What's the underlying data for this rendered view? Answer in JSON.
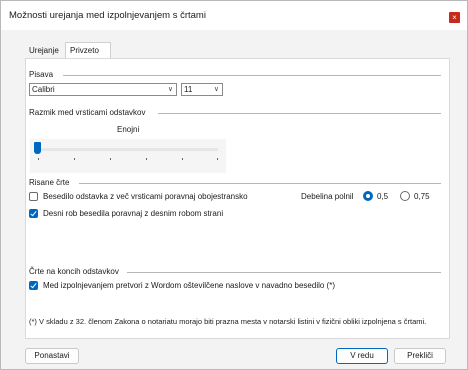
{
  "window": {
    "title": "Možnosti urejanja med izpolnjevanjem s črtami",
    "close_glyph": "×"
  },
  "tabs": [
    {
      "label": "Urejanje",
      "active": false
    },
    {
      "label": "Privzeto",
      "active": true
    }
  ],
  "font_group": {
    "label": "Pisava",
    "font_value": "Calibri",
    "size_value": "11",
    "dropdown_icon": "chevron-down-icon"
  },
  "spacing_group": {
    "label": "Razmik med vrsticami odstavkov",
    "slider_value_label": "Enojni",
    "slider_position": 0
  },
  "lines_group": {
    "label": "Risane črte",
    "justify_checkbox": {
      "label": "Besedilo odstavka z več vrsticami poravnaj obojestransko",
      "checked": false
    },
    "right_edge_checkbox": {
      "label": "Desni rob besedila poravnaj z desnim robom strani",
      "checked": true
    },
    "thickness_label": "Debelina polnil",
    "thickness_options": [
      {
        "label": "0,5",
        "checked": true
      },
      {
        "label": "0,75",
        "checked": false
      }
    ]
  },
  "paragraph_end_group": {
    "label": "Črte na koncih odstavkov",
    "convert_checkbox": {
      "label": "Med izpolnjevanjem pretvori z Wordom oštevilčene naslove v navadno besedilo (*)",
      "checked": true
    }
  },
  "footnote": "(*) V skladu z 32. členom Zakona o notariatu morajo biti prazna mesta v notarski listini v fizični obliki izpolnjena s črtami.",
  "buttons": {
    "reset": "Ponastavi",
    "ok": "V redu",
    "cancel": "Prekliči"
  },
  "colors": {
    "accent": "#0067c0",
    "close": "#c42b1c"
  }
}
